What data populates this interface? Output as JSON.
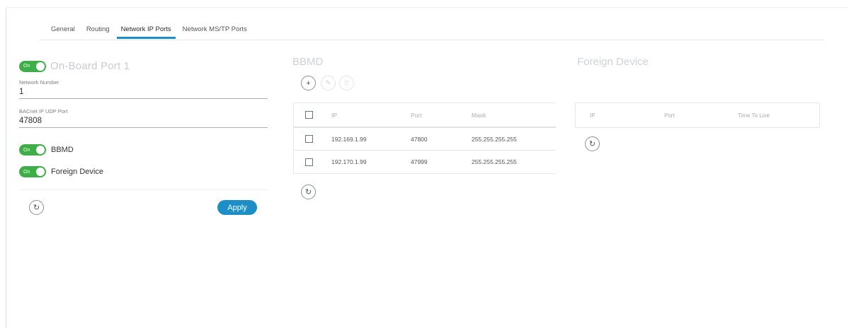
{
  "tabs": [
    {
      "label": "General",
      "active": false
    },
    {
      "label": "Routing",
      "active": false
    },
    {
      "label": "Network IP Ports",
      "active": true
    },
    {
      "label": "Network MS/TP Ports",
      "active": false
    }
  ],
  "port": {
    "toggle_label": "On",
    "title": "On-Board Port 1",
    "network_number_label": "Network Number",
    "network_number": "1",
    "udp_port_label": "BACnet IP UDP Port",
    "udp_port": "47808",
    "bbmd_toggle_label": "On",
    "bbmd_label": "BBMD",
    "foreign_toggle_label": "On",
    "foreign_label": "Foreign Device",
    "apply_label": "Apply"
  },
  "bbmd": {
    "title": "BBMD",
    "columns": {
      "ip": "IP",
      "port": "Port",
      "mask": "Mask"
    },
    "rows": [
      {
        "ip": "192.169.1.99",
        "port": "47800",
        "mask": "255.255.255.255"
      },
      {
        "ip": "192.170.1.99",
        "port": "47999",
        "mask": "255.255.255.255"
      }
    ]
  },
  "foreign_device": {
    "title": "Foreign Device",
    "columns": {
      "ip": "IP",
      "port": "Port",
      "ttl": "Time To Live"
    }
  },
  "icons": {
    "refresh": "↻",
    "add": "+",
    "edit": "✎",
    "delete": "🗑"
  },
  "colors": {
    "accent": "#1e8fc6",
    "toggle_on": "#3fae49"
  }
}
